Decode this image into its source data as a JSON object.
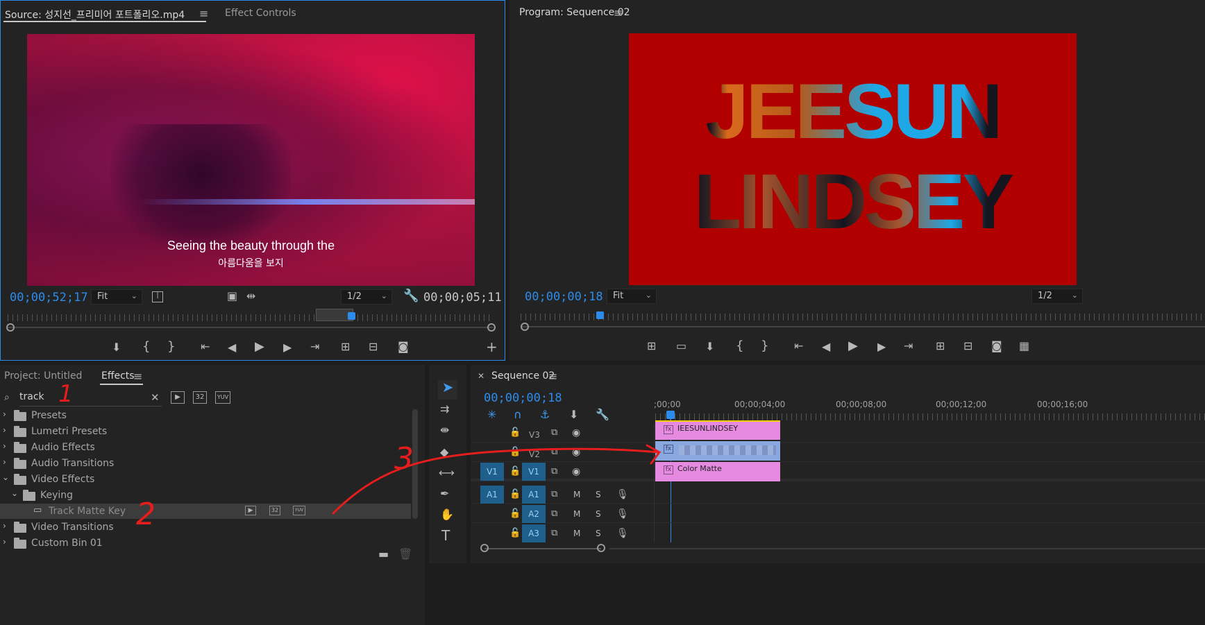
{
  "source_monitor": {
    "tab_source": "Source: 성지선_프리미어 포트폴리오.mp4",
    "tab_effect_controls": "Effect Controls",
    "subtitle_en": "Seeing the beauty through the",
    "subtitle_ko": "아름다움을 보지",
    "timecode_current": "00;00;52;17",
    "zoom": "Fit",
    "resolution": "1/2",
    "timecode_duration": "00;00;05;11"
  },
  "program_monitor": {
    "tab_program": "Program: Sequence 02",
    "title_line1": "JEESUN",
    "title_line2": "LINDSEY",
    "timecode_current": "00;00;00;18",
    "zoom": "Fit",
    "resolution": "1/2"
  },
  "effects_panel": {
    "tab_project": "Project: Untitled",
    "tab_effects": "Effects",
    "search_value": "track",
    "items": [
      {
        "label": "Presets"
      },
      {
        "label": "Lumetri Presets"
      },
      {
        "label": "Audio Effects"
      },
      {
        "label": "Audio Transitions"
      },
      {
        "label": "Video Effects"
      },
      {
        "label": "Keying"
      },
      {
        "label": "Track Matte Key"
      },
      {
        "label": "Video Transitions"
      },
      {
        "label": "Custom Bin 01"
      }
    ],
    "badge_32": "32",
    "badge_yuv": "YUV"
  },
  "timeline": {
    "tab_sequence": "Sequence 02",
    "timecode": "00;00;00;18",
    "ruler_labels": [
      ";00;00",
      "00;00;04;00",
      "00;00;08;00",
      "00;00;12;00",
      "00;00;16;00"
    ],
    "tracks_video": [
      {
        "name": "V3",
        "source": ""
      },
      {
        "name": "V2",
        "source": ""
      },
      {
        "name": "V1",
        "source": "V1"
      }
    ],
    "tracks_audio": [
      {
        "name": "A1",
        "source": "A1"
      },
      {
        "name": "A2",
        "source": ""
      },
      {
        "name": "A3",
        "source": ""
      }
    ],
    "mute_label": "M",
    "solo_label": "S",
    "clips": {
      "v3": "IEESUNLINDSEY",
      "v1": "Color Matte"
    }
  },
  "annotations": [
    "1",
    "2",
    "3"
  ],
  "colors": {
    "accent_blue": "#2d8ceb",
    "clip_pink": "#e58ae0",
    "clip_blue": "#8aa8e0",
    "program_bg": "#b00000",
    "annotation_red": "#e51d1d"
  }
}
